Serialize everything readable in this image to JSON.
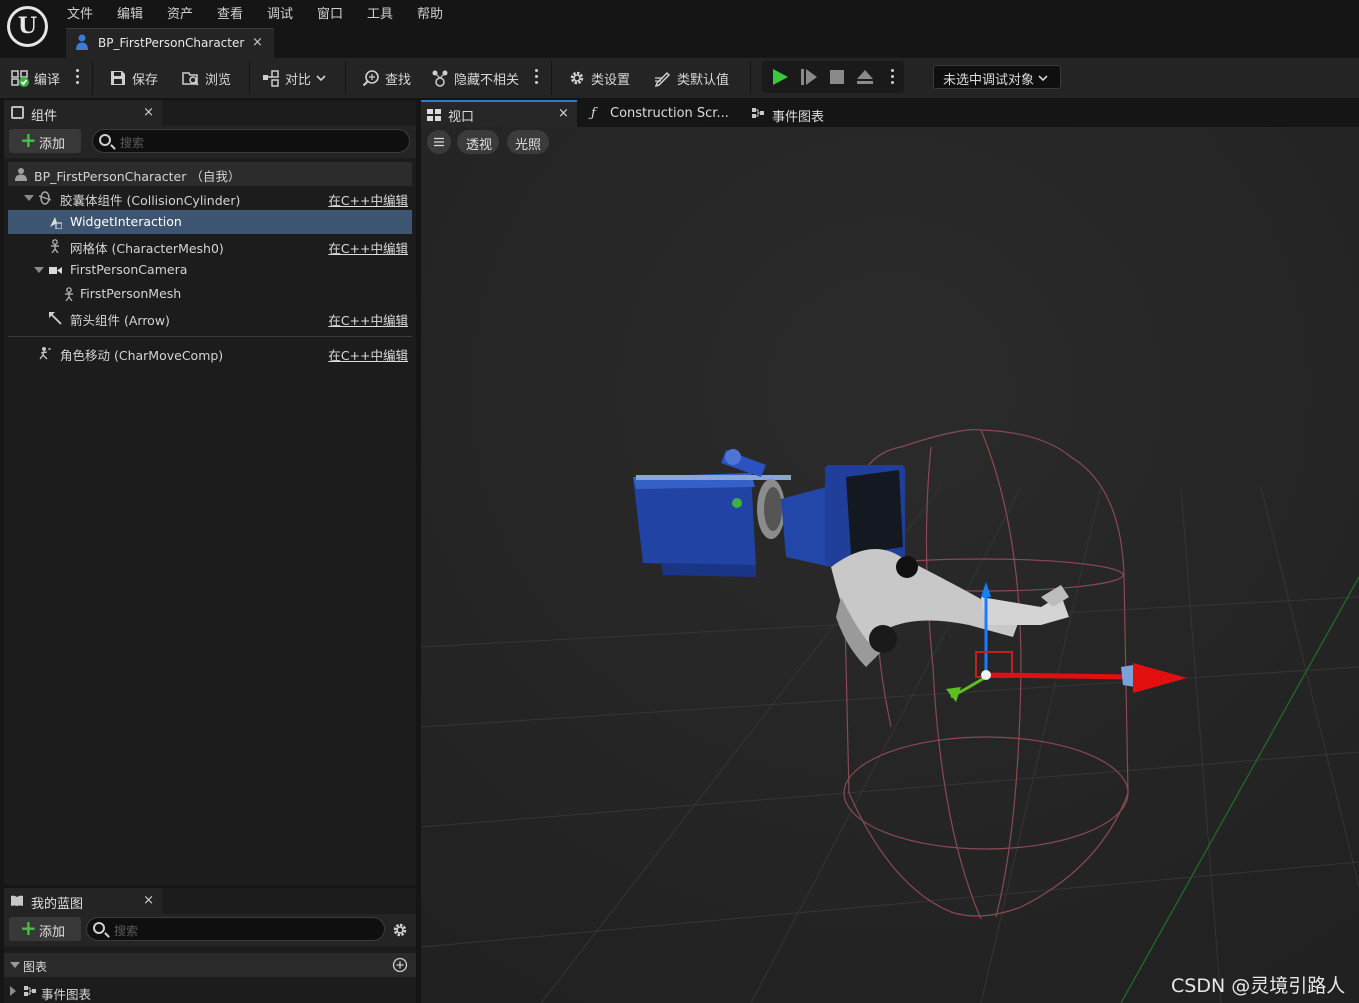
{
  "menu": {
    "items": [
      "文件",
      "编辑",
      "资产",
      "查看",
      "调试",
      "窗口",
      "工具",
      "帮助"
    ]
  },
  "asset_tab": {
    "label": "BP_FirstPersonCharacter",
    "close": "×"
  },
  "toolbar": {
    "compile": "编译",
    "save": "保存",
    "browse": "浏览",
    "diff": "对比",
    "find": "查找",
    "hide_unrelated": "隐藏不相关",
    "class_settings": "类设置",
    "class_defaults": "类默认值",
    "debug_target": "未选中调试对象"
  },
  "components": {
    "tab_title": "组件",
    "close": "×",
    "add_label": "添加",
    "search_placeholder": "搜索",
    "root_label": "BP_FirstPersonCharacter （自我）",
    "edit_in_cpp": "在C++中编辑",
    "tree": [
      {
        "label": "胶囊体组件 (CollisionCylinder)",
        "icon": "capsule-icon",
        "edit": true
      },
      {
        "label": "WidgetInteraction",
        "icon": "widget-interaction-icon",
        "edit": false,
        "selected": true
      },
      {
        "label": "网格体 (CharacterMesh0)",
        "icon": "skeletal-mesh-icon",
        "edit": true
      },
      {
        "label": "FirstPersonCamera",
        "icon": "camera-icon",
        "edit": false
      },
      {
        "label": "FirstPersonMesh",
        "icon": "skeletal-mesh-icon",
        "edit": false
      },
      {
        "label": "箭头组件 (Arrow)",
        "icon": "arrow-component-icon",
        "edit": true
      }
    ],
    "movement": {
      "label": "角色移动 (CharMoveComp)",
      "icon": "movement-icon",
      "edit": true
    }
  },
  "my_blueprint": {
    "tab_title": "我的蓝图",
    "close": "×",
    "add_label": "添加",
    "search_placeholder": "搜索",
    "category": "图表",
    "graph_item": "事件图表"
  },
  "viewport_tabs": {
    "viewport": "视口",
    "close": "×",
    "construction": "Construction Scr...",
    "event_graph": "事件图表"
  },
  "viewport": {
    "perspective": "透视",
    "lighting": "光照"
  },
  "watermark": "CSDN @灵境引路人",
  "colors": {
    "selection": "#3d5571",
    "play_green": "#3cc83c",
    "axis_x": "#e01010",
    "axis_y": "#5cc020",
    "axis_z": "#1a7cff",
    "capsule": "#8a4a52"
  }
}
